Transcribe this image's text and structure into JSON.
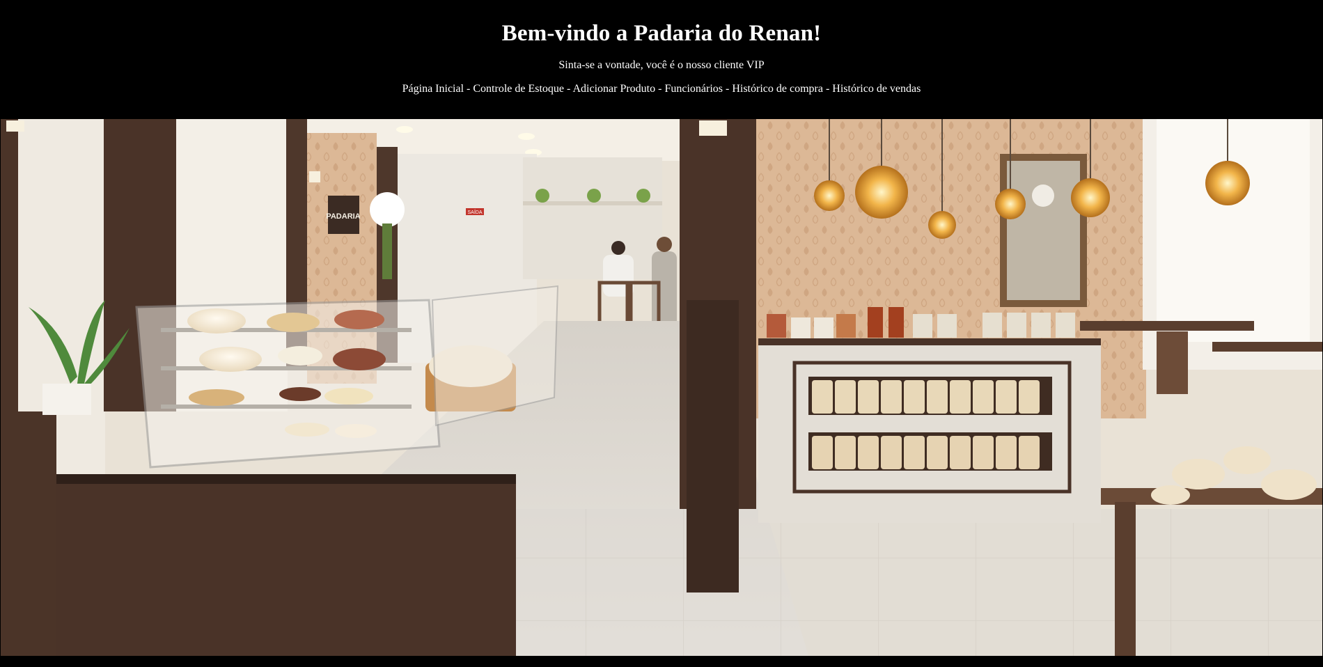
{
  "header": {
    "title": "Bem-vindo a Padaria do Renan!",
    "subtitle": "Sinta-se a vontade, você é o nosso cliente VIP",
    "separator": " - ",
    "nav": [
      {
        "label": "Página Inicial"
      },
      {
        "label": "Controle de Estoque"
      },
      {
        "label": "Adicionar Produto"
      },
      {
        "label": "Funcionários"
      },
      {
        "label": "Histórico de compra"
      },
      {
        "label": "Histórico de vendas"
      }
    ]
  },
  "hero": {
    "sign_padaria": "PADARIA",
    "sign_saida": "SAÍDA"
  },
  "colors": {
    "background": "#000000",
    "text": "#ffffff",
    "wood_dark": "#4a3328",
    "wall_cream": "#efe6d6",
    "floor": "#dcd8d2",
    "wallpaper": "#d9b48e"
  }
}
